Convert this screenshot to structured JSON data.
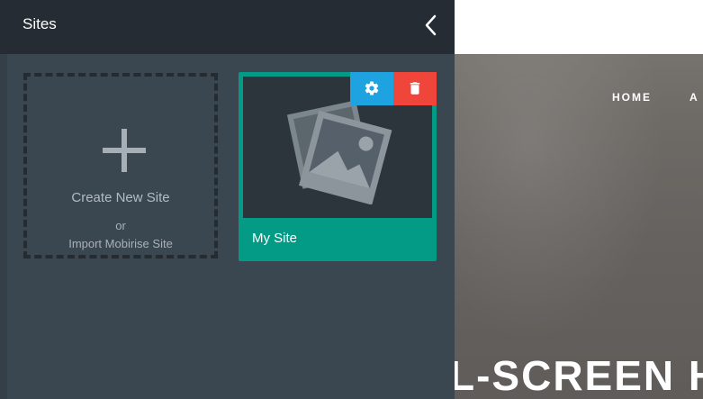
{
  "panel": {
    "title": "Sites",
    "create_card": {
      "label": "Create New Site",
      "or": "or",
      "import": "Import Mobirise Site"
    },
    "sites": [
      {
        "name": "My Site"
      }
    ],
    "icons": {
      "close": "chevron-left-icon",
      "create": "plus-icon",
      "settings": "gear-icon",
      "delete": "trash-icon",
      "thumbnail": "photos-icon"
    }
  },
  "preview": {
    "nav": [
      "HOME",
      "A"
    ],
    "headline": "L-SCREEN HI"
  },
  "colors": {
    "panel_bg": "#3a4650",
    "header_bg": "#252c33",
    "site_card": "#039a86",
    "settings": "#1fa2e0",
    "delete": "#f0453a"
  }
}
